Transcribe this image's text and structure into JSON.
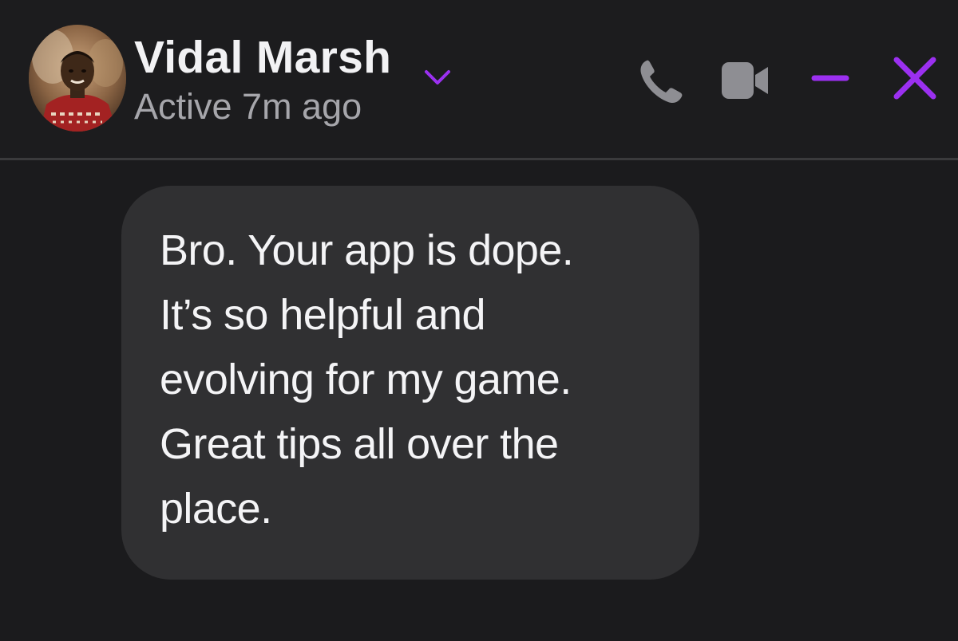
{
  "header": {
    "contact_name": "Vidal Marsh",
    "status": "Active 7m ago",
    "avatar_icon": "avatar-photo",
    "expand_icon": "chevron-down-icon",
    "actions": [
      {
        "name": "phone-icon",
        "color": "#8e8e93"
      },
      {
        "name": "video-camera-icon",
        "color": "#8e8e93"
      },
      {
        "name": "minimize-icon",
        "color": "#9b30f0"
      },
      {
        "name": "close-icon",
        "color": "#9b30f0"
      }
    ]
  },
  "colors": {
    "accent": "#9b30f0",
    "icon_gray": "#8e8e93",
    "background": "#1b1b1d",
    "bubble": "#303032",
    "primary_text": "#f4f4f6",
    "secondary_text": "#a6a6ab"
  },
  "conversation": {
    "message": {
      "lines": [
        "Bro. Your app is dope.",
        "It’s so helpful and",
        "evolving for my game.",
        "Great tips all over the",
        "place."
      ]
    }
  }
}
